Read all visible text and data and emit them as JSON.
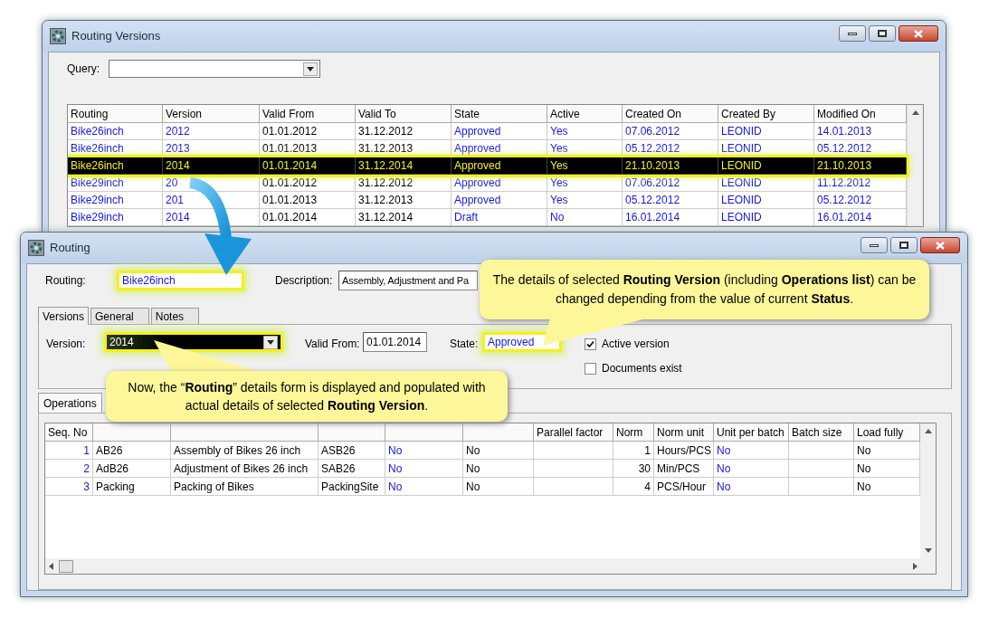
{
  "versions_window": {
    "title": "Routing Versions",
    "query": {
      "label": "Query:"
    },
    "table": {
      "columns": [
        {
          "label": "Routing",
          "link": true
        },
        {
          "label": "Version",
          "link": true
        },
        {
          "label": "Valid From",
          "link": false
        },
        {
          "label": "Valid To",
          "link": false
        },
        {
          "label": "State",
          "link": true
        },
        {
          "label": "Active",
          "link": true
        },
        {
          "label": "Created On",
          "link": true
        },
        {
          "label": "Created By",
          "link": true
        },
        {
          "label": "Modified On",
          "link": true
        }
      ],
      "rows": [
        {
          "cells": [
            "Bike26inch",
            "2012",
            "01.01.2012",
            "31.12.2012",
            "Approved",
            "Yes",
            "07.06.2012",
            "LEONID",
            "14.01.2013"
          ],
          "selected": false
        },
        {
          "cells": [
            "Bike26inch",
            "2013",
            "01.01.2013",
            "31.12.2013",
            "Approved",
            "Yes",
            "05.12.2012",
            "LEONID",
            "05.12.2012"
          ],
          "selected": false
        },
        {
          "cells": [
            "Bike26inch",
            "2014",
            "01.01.2014",
            "31.12.2014",
            "Approved",
            "Yes",
            "21.10.2013",
            "LEONID",
            "21.10.2013"
          ],
          "selected": true
        },
        {
          "cells": [
            "Bike29inch",
            "20",
            "01.01.2012",
            "31.12.2012",
            "Approved",
            "Yes",
            "07.06.2012",
            "LEONID",
            "11.12.2012"
          ],
          "selected": false
        },
        {
          "cells": [
            "Bike29inch",
            "201",
            "01.01.2013",
            "31.12.2013",
            "Approved",
            "Yes",
            "05.12.2012",
            "LEONID",
            "05.12.2012"
          ],
          "selected": false
        },
        {
          "cells": [
            "Bike29inch",
            "2014",
            "01.01.2014",
            "31.12.2014",
            "Draft",
            "No",
            "16.01.2014",
            "LEONID",
            "16.01.2014"
          ],
          "selected": false
        }
      ]
    }
  },
  "routing_window": {
    "title": "Routing",
    "routing": {
      "label": "Routing:",
      "value": "Bike26inch",
      "highlighted": true
    },
    "description": {
      "label": "Description:",
      "value": "Assembly, Adjustment and Pa",
      "highlighted": false
    },
    "tabs": [
      {
        "label": "Versions",
        "selected": true
      },
      {
        "label": "General",
        "selected": false
      },
      {
        "label": "Notes",
        "selected": false
      }
    ],
    "version": {
      "label": "Version:",
      "value": "2014",
      "highlighted": true
    },
    "valid_from": {
      "label": "Valid From:",
      "value": "01.01.2014",
      "highlighted": false
    },
    "state": {
      "label": "State:",
      "value": "Approved",
      "highlighted": true
    },
    "checkboxes": [
      {
        "label": "Active version",
        "checked": true
      },
      {
        "label": "Documents exist",
        "checked": false
      }
    ],
    "subtabs": [
      {
        "label": "Operations",
        "selected": true
      }
    ],
    "operations": {
      "columns": [
        {
          "label": "Seq. No",
          "link": true
        },
        {
          "link": false
        },
        {
          "link": false
        },
        {
          "link": false
        },
        {
          "link": true
        },
        {
          "link": false
        },
        {
          "label": "Parallel factor"
        },
        {
          "label": "Norm",
          "link": false
        },
        {
          "label": "Norm unit",
          "link": false
        },
        {
          "label": "Unit per batch",
          "link": true
        },
        {
          "label": "Batch size"
        },
        {
          "label": "Load fully",
          "link": false
        }
      ],
      "rows": [
        {
          "cells": [
            "1",
            "AB26",
            "Assembly of Bikes 26 inch",
            "ASB26",
            "No",
            "No",
            null,
            "1",
            "Hours/PCS",
            "No",
            null,
            "No"
          ]
        },
        {
          "cells": [
            "2",
            "AdB26",
            "Adjustment of Bikes 26 inch",
            "SAB26",
            "No",
            "No",
            null,
            "30",
            "Min/PCS",
            "No",
            null,
            "No"
          ]
        },
        {
          "cells": [
            "3",
            "Packing",
            "Packing of Bikes",
            "PackingSite",
            "No",
            "No",
            null,
            "4",
            "PCS/Hour",
            "No",
            null,
            "No"
          ]
        }
      ]
    }
  },
  "callouts": [
    {
      "text": "The details of selected **Routing Version** (including **Operations list**) can be changed depending from the value of current **Status**."
    },
    {
      "text": "Now, the “**Routing**” details form is displayed and populated with actual details of selected **Routing Version**."
    }
  ]
}
